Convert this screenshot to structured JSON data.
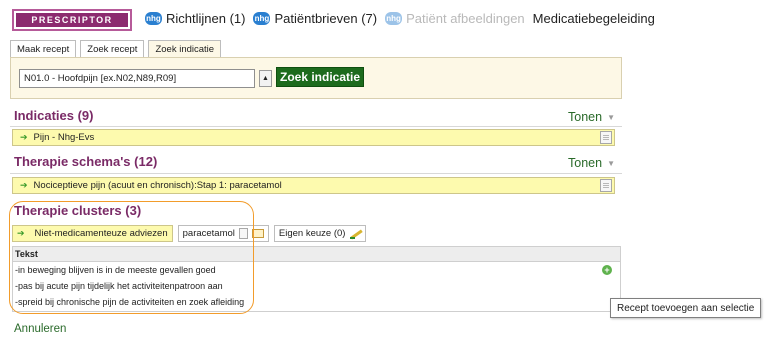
{
  "app": {
    "brand": "PRESCRIPTOR"
  },
  "nav": [
    {
      "badge": "nhg",
      "label": "Richtlijnen (1)",
      "enabled": true
    },
    {
      "badge": "nhg",
      "label": "Patiëntbrieven (7)",
      "enabled": true
    },
    {
      "badge": "nhg",
      "label": "Patiënt afbeeldingen",
      "enabled": false
    },
    {
      "badge": "",
      "label": "Medicatiebegeleiding",
      "enabled": true
    }
  ],
  "tabs": [
    {
      "label": "Maak recept"
    },
    {
      "label": "Zoek recept"
    },
    {
      "label": "Zoek indicatie",
      "active": true
    }
  ],
  "search": {
    "value": "N01.0 - Hoofdpijn [ex.N02,N89,R09]",
    "dropdown_glyph": "▲",
    "button": "Zoek indicatie"
  },
  "indicaties": {
    "title": "Indicaties (9)",
    "toggle": "Tonen",
    "row": "Pijn - Nhg-Evs"
  },
  "therapie_schemas": {
    "title": "Therapie schema's (12)",
    "toggle": "Tonen",
    "row": "Nociceptieve pijn (acuut en chronisch):Stap 1: paracetamol"
  },
  "clusters": {
    "title": "Therapie clusters (3)",
    "items": [
      {
        "label": "Niet-medicamenteuze adviezen"
      },
      {
        "label": "paracetamol"
      },
      {
        "label": "Eigen keuze (0)"
      }
    ]
  },
  "table": {
    "header": "Tekst",
    "rows": [
      "-in beweging blijven is in de meeste gevallen goed",
      "-pas bij acute pijn tijdelijk het activiteitenpatroon aan",
      "-spreid bij chronische pijn de activiteiten en zoek afleiding"
    ],
    "add_glyph": "+"
  },
  "tooltip": "Recept toevoegen aan selectie",
  "cancel": "Annuleren",
  "colors": {
    "brand": "#8c2a6f",
    "section_title": "#7a2a66",
    "link_green": "#2a6a2a",
    "button_green": "#1d6b1d",
    "row_yellow": "#fdfaae",
    "panel_cream": "#fdf8e6",
    "highlight_orange": "#f29c2b"
  },
  "icons": {
    "arrow": "green-arrow-icon",
    "document": "document-icon",
    "add": "plus-circle-icon",
    "edit": "pencil-icon",
    "note": "note-icon"
  }
}
